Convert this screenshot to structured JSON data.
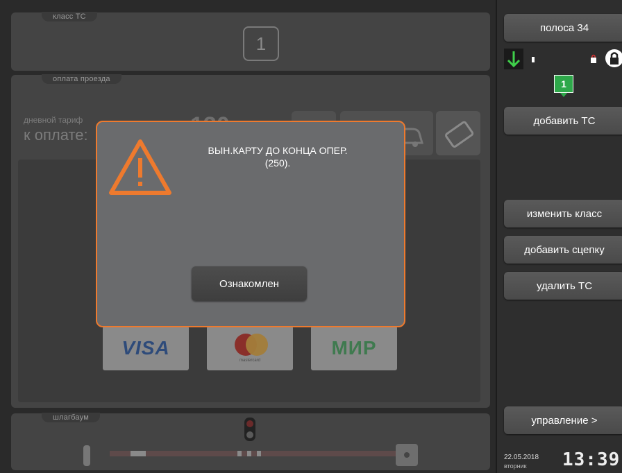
{
  "vehicle_class_panel": {
    "title": "класс ТС",
    "class_value": "1"
  },
  "payment_panel": {
    "title": "оплата проезда",
    "tariff_label": "дневной тариф",
    "to_pay_label": "к оплате:",
    "amount_partial": "130",
    "cards": {
      "visa": "VISA",
      "mastercard": "mastercard",
      "mir": "МИР"
    }
  },
  "barrier_panel": {
    "title": "шлагбаум"
  },
  "modal": {
    "message_line1": "ВЫН.КАРТУ ДО КОНЦА ОПЕР.",
    "message_line2": "(250).",
    "ack_button": "Ознакомлен",
    "warning_color": "#ee7a2e",
    "icon": "warning-triangle-icon"
  },
  "sidebar": {
    "lane_button": "полоса 34",
    "lane_number_badge": "1",
    "add_vehicle_button": "добавить ТС",
    "change_class_button": "изменить класс",
    "add_trailer_button": "добавить сцепку",
    "delete_vehicle_button": "удалить ТС",
    "control_button": "управление >",
    "date": "22.05.2018",
    "weekday": "вторник",
    "time": "13:39",
    "status_icons": [
      "down-arrow-icon",
      "indicator-dot-icon",
      "small-lock-icon",
      "padlock-icon"
    ]
  }
}
